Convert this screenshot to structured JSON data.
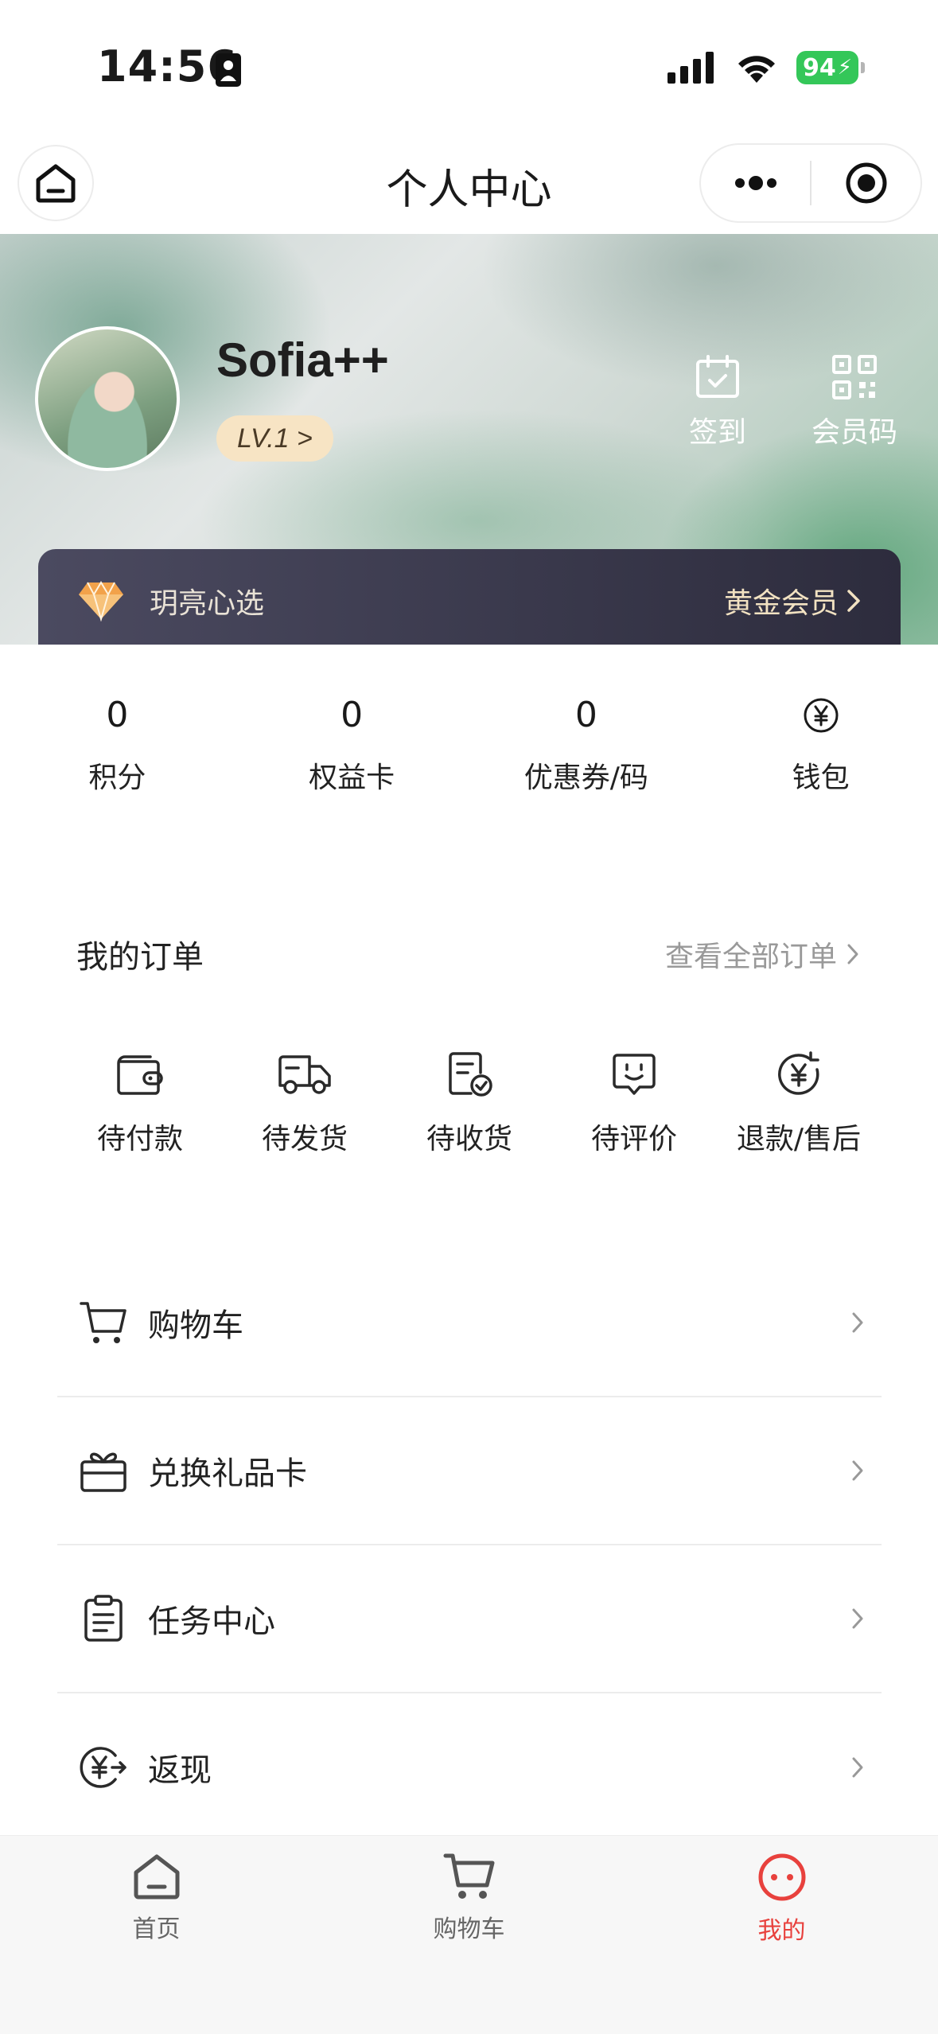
{
  "status_bar": {
    "time": "14:56",
    "battery": "94"
  },
  "nav": {
    "title": "个人中心"
  },
  "profile": {
    "username": "Sofia++",
    "level": "LV.1 >",
    "actions": [
      {
        "label": "签到",
        "icon": "calendar-check-icon"
      },
      {
        "label": "会员码",
        "icon": "qr-code-icon"
      }
    ]
  },
  "membership": {
    "store_name": "玥亮心选",
    "tier": "黄金会员"
  },
  "stats": [
    {
      "value": "0",
      "label": "积分"
    },
    {
      "value": "0",
      "label": "权益卡"
    },
    {
      "value": "0",
      "label": "优惠券/码"
    },
    {
      "value": "",
      "label": "钱包",
      "icon": "yen-circle-icon"
    }
  ],
  "orders": {
    "title": "我的订单",
    "view_all": "查看全部订单",
    "items": [
      {
        "label": "待付款",
        "icon": "wallet-icon"
      },
      {
        "label": "待发货",
        "icon": "truck-icon"
      },
      {
        "label": "待收货",
        "icon": "receipt-check-icon"
      },
      {
        "label": "待评价",
        "icon": "smile-chat-icon"
      },
      {
        "label": "退款/售后",
        "icon": "refund-icon"
      }
    ]
  },
  "menu": [
    {
      "label": "购物车",
      "icon": "cart-icon"
    },
    {
      "label": "兑换礼品卡",
      "icon": "gift-card-icon"
    },
    {
      "label": "任务中心",
      "icon": "clipboard-icon"
    },
    {
      "label": "返现",
      "icon": "cashback-icon"
    }
  ],
  "tab_bar": [
    {
      "label": "首页",
      "icon": "home-icon",
      "active": false
    },
    {
      "label": "购物车",
      "icon": "cart-icon",
      "active": false
    },
    {
      "label": "我的",
      "icon": "profile-face-icon",
      "active": true
    }
  ],
  "colors": {
    "accent": "#e8413d",
    "battery": "#34c759",
    "member_bar": "#2d2c3d",
    "level_badge": "#f7e4c4"
  }
}
